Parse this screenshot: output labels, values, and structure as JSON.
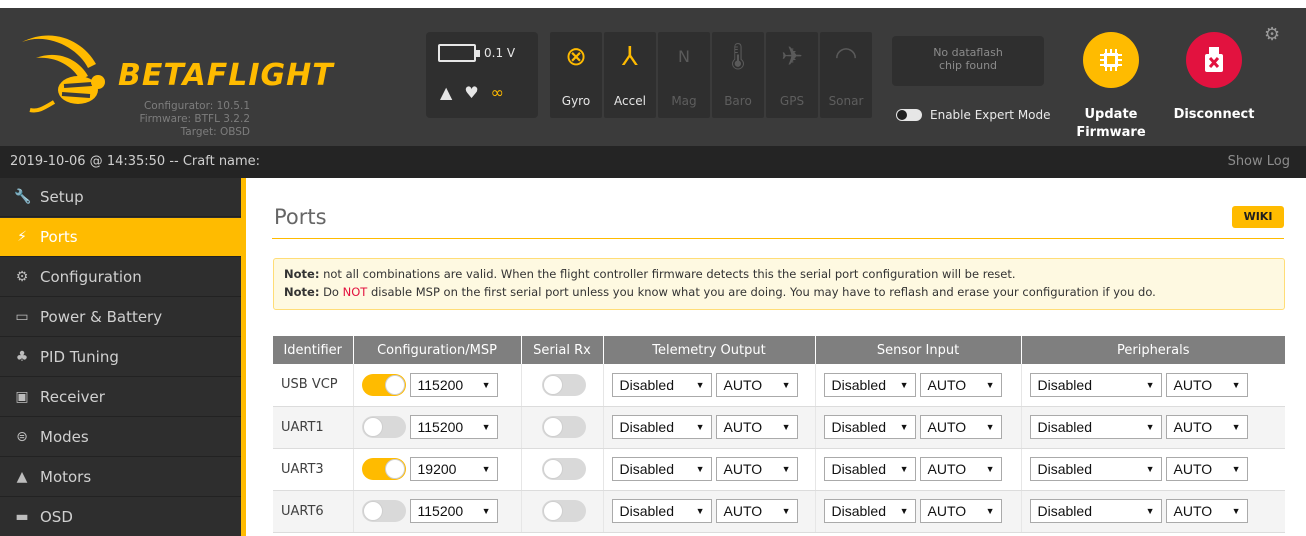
{
  "header": {
    "brand": "BETAFLIGHT",
    "info": [
      "Configurator: 10.5.1",
      "Firmware: BTFL 3.2.2",
      "Target: OBSD"
    ],
    "battery_voltage": "0.1 V",
    "status_icons": [
      "warning-icon",
      "parachute-icon",
      "link-icon"
    ],
    "sensors": [
      {
        "label": "Gyro",
        "icon": "⊗",
        "active": true
      },
      {
        "label": "Accel",
        "icon": "⅄",
        "active": true
      },
      {
        "label": "Mag",
        "icon": "N",
        "active": false
      },
      {
        "label": "Baro",
        "icon": "🌡",
        "active": false
      },
      {
        "label": "GPS",
        "icon": "✈",
        "active": false
      },
      {
        "label": "Sonar",
        "icon": "◠",
        "active": false
      }
    ],
    "dataflash_line1": "No dataflash",
    "dataflash_line2": "chip found",
    "expert_mode_label": "Enable Expert Mode",
    "update_label_1": "Update",
    "update_label_2": "Firmware",
    "disconnect_label": "Disconnect"
  },
  "statusbar": {
    "datetime": "2019-10-06 @ 14:35:50 -- Craft name:",
    "show_log": "Show Log"
  },
  "sidebar": {
    "items": [
      {
        "label": "Setup",
        "icon": "wrench-icon",
        "glyph": "🔧",
        "active": false
      },
      {
        "label": "Ports",
        "icon": "plug-icon",
        "glyph": "⚡",
        "active": true
      },
      {
        "label": "Configuration",
        "icon": "gear-icon",
        "glyph": "⚙",
        "active": false
      },
      {
        "label": "Power & Battery",
        "icon": "battery-icon",
        "glyph": "▭",
        "active": false
      },
      {
        "label": "PID Tuning",
        "icon": "pid-icon",
        "glyph": "♣",
        "active": false
      },
      {
        "label": "Receiver",
        "icon": "receiver-icon",
        "glyph": "▣",
        "active": false
      },
      {
        "label": "Modes",
        "icon": "modes-icon",
        "glyph": "⊜",
        "active": false
      },
      {
        "label": "Motors",
        "icon": "motor-icon",
        "glyph": "▲",
        "active": false
      },
      {
        "label": "OSD",
        "icon": "osd-icon",
        "glyph": "▬",
        "active": false
      }
    ]
  },
  "main": {
    "title": "Ports",
    "wiki": "WIKI",
    "note1_bold": "Note:",
    "note1_text": " not all combinations are valid. When the flight controller firmware detects this the serial port configuration will be reset.",
    "note2_bold": "Note:",
    "note2_pre": " Do ",
    "note2_red": "NOT",
    "note2_post": " disable MSP on the first serial port unless you know what you are doing. You may have to reflash and erase your configuration if you do."
  },
  "table": {
    "headers": [
      "Identifier",
      "Configuration/MSP",
      "Serial Rx",
      "Telemetry Output",
      "Sensor Input",
      "Peripherals"
    ],
    "rows": [
      {
        "id": "USB VCP",
        "msp": true,
        "baud": "115200",
        "rx": false,
        "telem": "Disabled",
        "telem_baud": "AUTO",
        "sensor": "Disabled",
        "sensor_baud": "AUTO",
        "periph": "Disabled",
        "periph_baud": "AUTO"
      },
      {
        "id": "UART1",
        "msp": false,
        "baud": "115200",
        "rx": false,
        "telem": "Disabled",
        "telem_baud": "AUTO",
        "sensor": "Disabled",
        "sensor_baud": "AUTO",
        "periph": "Disabled",
        "periph_baud": "AUTO"
      },
      {
        "id": "UART3",
        "msp": true,
        "baud": "19200",
        "rx": false,
        "telem": "Disabled",
        "telem_baud": "AUTO",
        "sensor": "Disabled",
        "sensor_baud": "AUTO",
        "periph": "Disabled",
        "periph_baud": "AUTO"
      },
      {
        "id": "UART6",
        "msp": false,
        "baud": "115200",
        "rx": false,
        "telem": "Disabled",
        "telem_baud": "AUTO",
        "sensor": "Disabled",
        "sensor_baud": "AUTO",
        "periph": "Disabled",
        "periph_baud": "AUTO"
      }
    ]
  },
  "colors": {
    "accent": "#ffbb00",
    "danger": "#e2123f",
    "header_bg": "#3b3b3b",
    "sidebar_bg": "#2e2e2e"
  }
}
